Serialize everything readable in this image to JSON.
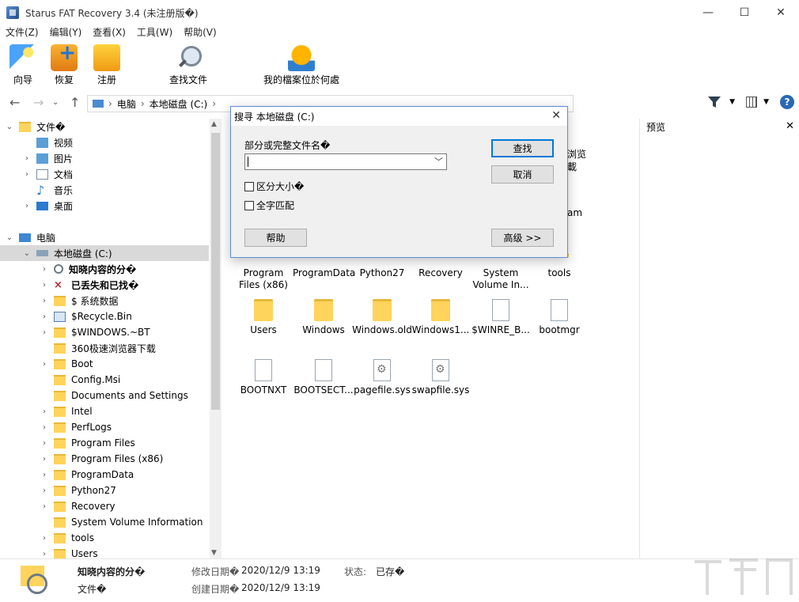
{
  "window": {
    "title": "Starus FAT Recovery 3.4 (未注册版�)",
    "controls": [
      "minimize",
      "maximize",
      "close"
    ]
  },
  "menu": [
    "文件(Z)",
    "编辑(Y)",
    "查看(X)",
    "工具(W)",
    "帮助(V)"
  ],
  "toolbar": {
    "wizard": "向导",
    "restore": "恢复",
    "register": "注册",
    "find": "查找文件",
    "locate": "我的檔案位於何處"
  },
  "address": {
    "crumbs": [
      "电脑",
      "本地磁盘 (C:)"
    ]
  },
  "tree": [
    {
      "label": "文件�",
      "expand": "open",
      "icon": "folder"
    },
    {
      "label": "视频",
      "expand": "",
      "icon": "img"
    },
    {
      "label": "图片",
      "expand": "closed",
      "icon": "img"
    },
    {
      "label": "文档",
      "expand": "closed",
      "icon": "doc"
    },
    {
      "label": "音乐",
      "expand": "",
      "icon": "music"
    },
    {
      "label": "桌面",
      "expand": "closed",
      "icon": "desk"
    },
    {
      "label": "电脑",
      "expand": "open",
      "icon": "pc"
    },
    {
      "label": "本地磁盘 (C:)",
      "expand": "open",
      "icon": "drv"
    },
    {
      "label": "知晓内容的分�",
      "expand": "closed",
      "icon": "search"
    },
    {
      "label": "已丢失和已找�",
      "expand": "closed",
      "icon": "lost"
    },
    {
      "label": "$ 系统数据",
      "expand": "closed",
      "icon": "folder"
    },
    {
      "label": "$Recycle.Bin",
      "expand": "closed",
      "icon": "recycle"
    },
    {
      "label": "$WINDOWS.~BT",
      "expand": "closed",
      "icon": "folder"
    },
    {
      "label": "360极速浏览器下载",
      "expand": "",
      "icon": "folder"
    },
    {
      "label": "Boot",
      "expand": "closed",
      "icon": "folder"
    },
    {
      "label": "Config.Msi",
      "expand": "",
      "icon": "folder"
    },
    {
      "label": "Documents and Settings",
      "expand": "",
      "icon": "folder"
    },
    {
      "label": "Intel",
      "expand": "closed",
      "icon": "folder"
    },
    {
      "label": "PerfLogs",
      "expand": "closed",
      "icon": "folder"
    },
    {
      "label": "Program Files",
      "expand": "closed",
      "icon": "folder"
    },
    {
      "label": "Program Files (x86)",
      "expand": "closed",
      "icon": "folder"
    },
    {
      "label": "ProgramData",
      "expand": "closed",
      "icon": "folder"
    },
    {
      "label": "Python27",
      "expand": "closed",
      "icon": "folder"
    },
    {
      "label": "Recovery",
      "expand": "closed",
      "icon": "folder"
    },
    {
      "label": "System Volume Information",
      "expand": "",
      "icon": "folder"
    },
    {
      "label": "tools",
      "expand": "closed",
      "icon": "folder"
    },
    {
      "label": "Users",
      "expand": "closed",
      "icon": "folder"
    }
  ],
  "files": {
    "partial": [
      "浏览",
      "載",
      "am"
    ],
    "row1": [
      {
        "name": "Program\nFiles (x86)",
        "type": "folder"
      },
      {
        "name": "ProgramData",
        "type": "folder"
      },
      {
        "name": "Python27",
        "type": "folder"
      },
      {
        "name": "Recovery",
        "type": "folder"
      },
      {
        "name": "System\nVolume In...",
        "type": "folder"
      },
      {
        "name": "tools",
        "type": "folder"
      }
    ],
    "row2": [
      {
        "name": "Users",
        "type": "folder"
      },
      {
        "name": "Windows",
        "type": "folder"
      },
      {
        "name": "Windows.old",
        "type": "folder"
      },
      {
        "name": "Windows1...",
        "type": "folder"
      },
      {
        "name": "$WINRE_B...",
        "type": "file"
      },
      {
        "name": "bootmgr",
        "type": "file"
      }
    ],
    "row3": [
      {
        "name": "BOOTNXT",
        "type": "file"
      },
      {
        "name": "BOOTSECT...",
        "type": "file"
      },
      {
        "name": "pagefile.sys",
        "type": "sys"
      },
      {
        "name": "swapfile.sys",
        "type": "sys"
      }
    ]
  },
  "preview": {
    "title": "预览"
  },
  "status": {
    "name": "知晓内容的分�",
    "type": "文件�",
    "modified_label": "修改日期�",
    "modified_value": "2020/12/9 13:19",
    "created_label": "创建日期�",
    "created_value": "2020/12/9 13:19",
    "state_label": "状态:",
    "state_value": "已存�"
  },
  "dialog": {
    "title": "搜寻 本地磁盘 (C:)",
    "field_label": "部分或完整文件名�",
    "field_value": "",
    "case_label": "区分大小�",
    "whole_label": "全字匹配",
    "find_button": "查找",
    "cancel_button": "取消",
    "help_button": "帮助",
    "advanced_button": "高级 >>"
  }
}
